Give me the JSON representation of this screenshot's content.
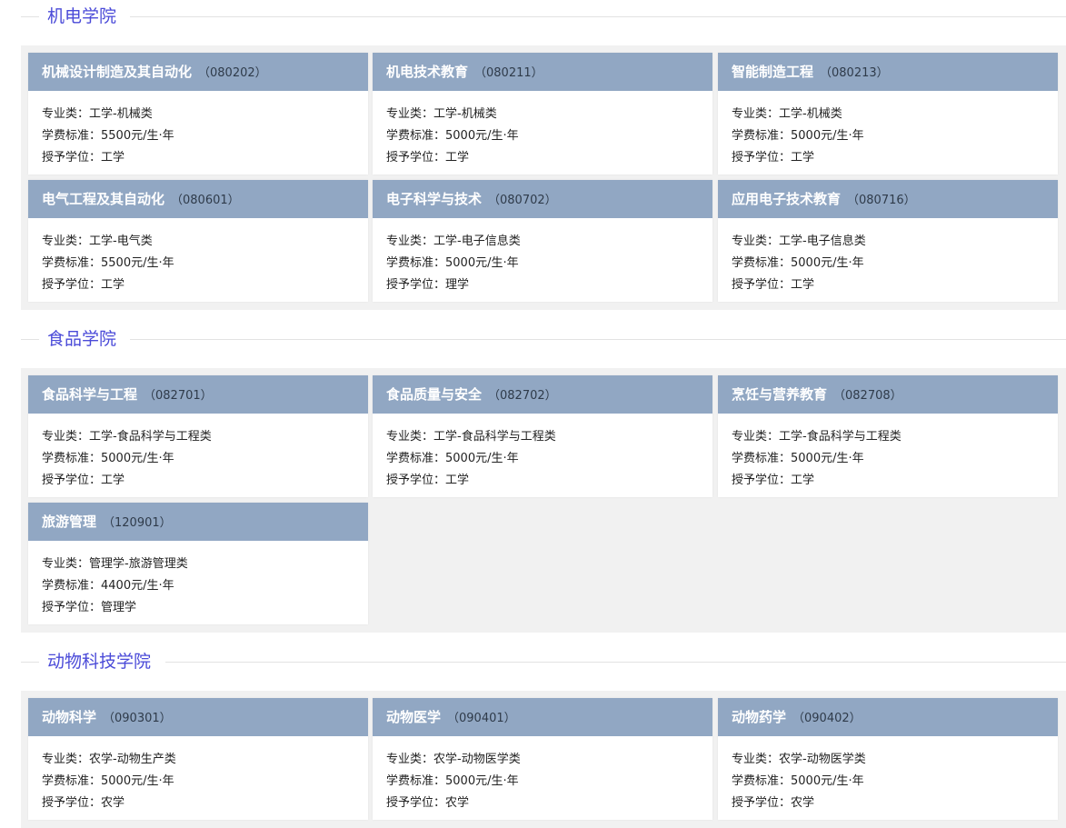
{
  "labels": {
    "category": "专业类：",
    "tuition": "学费标准：",
    "degree": "授予学位："
  },
  "colleges": [
    {
      "name": "机电学院",
      "majors": [
        {
          "name": "机械设计制造及其自动化",
          "code": "（080202）",
          "category": "工学-机械类",
          "tuition": "5500元/生·年",
          "degree": "工学"
        },
        {
          "name": "机电技术教育",
          "code": "（080211）",
          "category": "工学-机械类",
          "tuition": "5000元/生·年",
          "degree": "工学"
        },
        {
          "name": "智能制造工程",
          "code": "（080213）",
          "category": "工学-机械类",
          "tuition": "5000元/生·年",
          "degree": "工学"
        },
        {
          "name": "电气工程及其自动化",
          "code": "（080601）",
          "category": "工学-电气类",
          "tuition": "5500元/生·年",
          "degree": "工学"
        },
        {
          "name": "电子科学与技术",
          "code": "（080702）",
          "category": "工学-电子信息类",
          "tuition": "5000元/生·年",
          "degree": "理学"
        },
        {
          "name": "应用电子技术教育",
          "code": "（080716）",
          "category": "工学-电子信息类",
          "tuition": "5000元/生·年",
          "degree": "工学"
        }
      ]
    },
    {
      "name": "食品学院",
      "majors": [
        {
          "name": "食品科学与工程",
          "code": "（082701）",
          "category": "工学-食品科学与工程类",
          "tuition": "5000元/生·年",
          "degree": "工学"
        },
        {
          "name": "食品质量与安全",
          "code": "（082702）",
          "category": "工学-食品科学与工程类",
          "tuition": "5000元/生·年",
          "degree": "工学"
        },
        {
          "name": "烹饪与营养教育",
          "code": "（082708）",
          "category": "工学-食品科学与工程类",
          "tuition": "5000元/生·年",
          "degree": "工学"
        },
        {
          "name": "旅游管理",
          "code": "（120901）",
          "category": "管理学-旅游管理类",
          "tuition": "4400元/生·年",
          "degree": "管理学"
        }
      ]
    },
    {
      "name": "动物科技学院",
      "majors": [
        {
          "name": "动物科学",
          "code": "（090301）",
          "category": "农学-动物生产类",
          "tuition": "5000元/生·年",
          "degree": "农学"
        },
        {
          "name": "动物医学",
          "code": "（090401）",
          "category": "农学-动物医学类",
          "tuition": "5000元/生·年",
          "degree": "农学"
        },
        {
          "name": "动物药学",
          "code": "（090402）",
          "category": "农学-动物医学类",
          "tuition": "5000元/生·年",
          "degree": "农学"
        }
      ]
    }
  ]
}
